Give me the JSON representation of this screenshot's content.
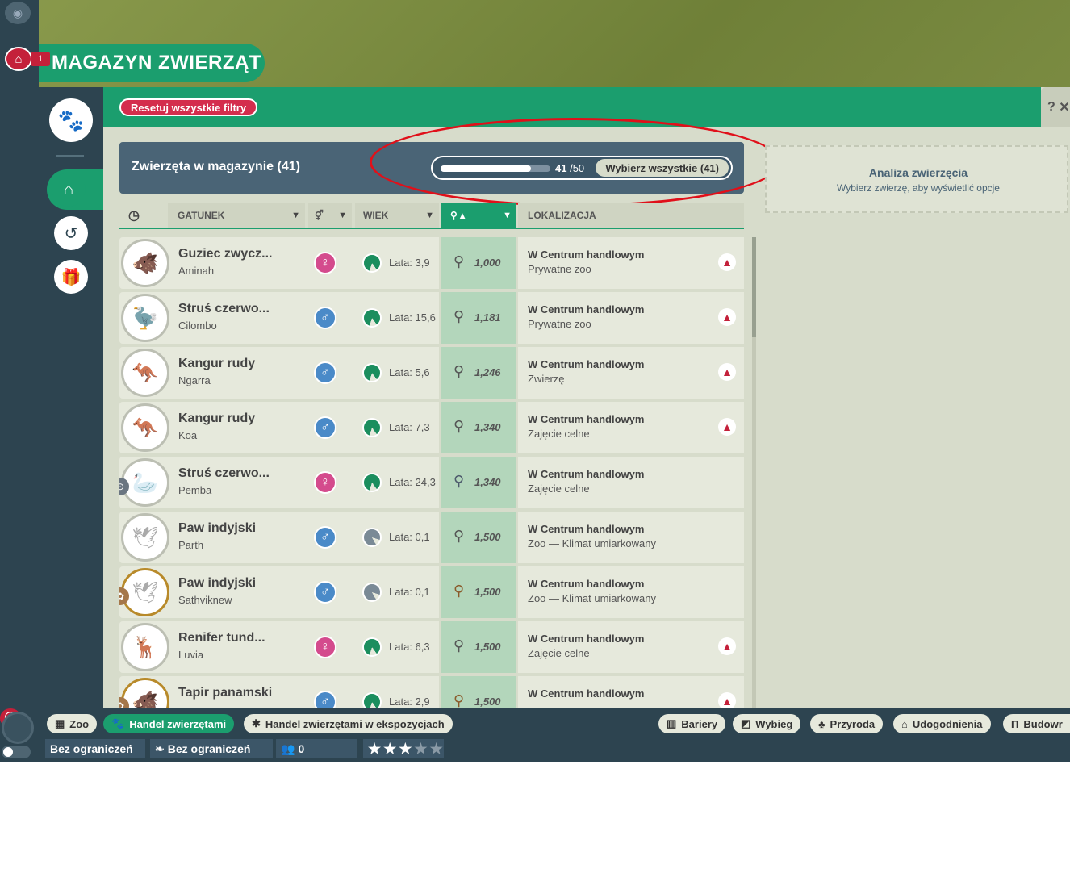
{
  "header": {
    "title": "MAGAZYN ZWIERZĄT",
    "notif_count": "1"
  },
  "toolbar": {
    "reset_label": "Resetuj wszystkie filtry",
    "help_label": "?"
  },
  "storage": {
    "title": "Zwierzęta w magazynie (41)",
    "current": "41",
    "capacity": "/50",
    "fill_fraction": 0.82,
    "select_all_label": "Wybierz wszystkie (41)"
  },
  "columns": {
    "species": "GATUNEK",
    "age": "WIEK",
    "location": "LOKALIZACJA"
  },
  "animals": [
    {
      "species": "Guziec zwycz...",
      "name": "Aminah",
      "sex": "f",
      "age": "Lata: 3,9",
      "rating": "1,000",
      "loc1": "W Centrum handlowym",
      "loc2": "Prywatne zoo",
      "warning": true,
      "avatar": "🐗"
    },
    {
      "species": "Struś czerwo...",
      "name": "Cilombo",
      "sex": "m",
      "age": "Lata: 15,6",
      "rating": "1,181",
      "loc1": "W Centrum handlowym",
      "loc2": "Prywatne zoo",
      "warning": true,
      "avatar": "🦤"
    },
    {
      "species": "Kangur rudy",
      "name": "Ngarra",
      "sex": "m",
      "age": "Lata: 5,6",
      "rating": "1,246",
      "loc1": "W Centrum handlowym",
      "loc2": "Zwierzę",
      "warning": true,
      "avatar": "🦘"
    },
    {
      "species": "Kangur rudy",
      "name": "Koa",
      "sex": "m",
      "age": "Lata: 7,3",
      "rating": "1,340",
      "loc1": "W Centrum handlowym",
      "loc2": "Zajęcie celne",
      "warning": true,
      "avatar": "🦘"
    },
    {
      "species": "Struś czerwo...",
      "name": "Pemba",
      "sex": "f",
      "age": "Lata: 24,3",
      "rating": "1,340",
      "loc1": "W Centrum handlowym",
      "loc2": "Zajęcie celne",
      "warning": false,
      "avatar": "🦢",
      "medal": "silver"
    },
    {
      "species": "Paw indyjski",
      "name": "Parth",
      "sex": "m",
      "age": "Lata: 0,1",
      "rating": "1,500",
      "loc1": "W Centrum handlowym",
      "loc2": "Zoo — Klimat umiarkowany",
      "warning": false,
      "avatar": "🕊",
      "young": true
    },
    {
      "species": "Paw indyjski",
      "name": "Sathviknew",
      "sex": "m",
      "age": "Lata: 0,1",
      "rating": "1,500",
      "loc1": "W Centrum handlowym",
      "loc2": "Zoo — Klimat umiarkowany",
      "warning": false,
      "avatar": "🕊",
      "young": true,
      "medal": "bronze"
    },
    {
      "species": "Renifer tund...",
      "name": "Luvia",
      "sex": "f",
      "age": "Lata: 6,3",
      "rating": "1,500",
      "loc1": "W Centrum handlowym",
      "loc2": "Zajęcie celne",
      "warning": true,
      "avatar": "🦌"
    },
    {
      "species": "Tapir panamski",
      "name": "",
      "sex": "m",
      "age": "Lata: 2,9",
      "rating": "1,500",
      "loc1": "W Centrum handlowym",
      "loc2": "",
      "warning": true,
      "avatar": "🐗",
      "medal": "bronze"
    }
  ],
  "analysis": {
    "title": "Analiza zwierzęcia",
    "subtitle": "Wybierz zwierzę, aby wyświetlić opcje"
  },
  "bottom_tabs": {
    "zoo": "Zoo",
    "trade": "Handel zwierzętami",
    "exhibit": "Handel zwierzętami w ekspozycjach",
    "barriers": "Bariery",
    "habitat": "Wybieg",
    "nature": "Przyroda",
    "facilities": "Udogodnienia",
    "build": "Budowr"
  },
  "stats": {
    "money": "Bez ograniczeń",
    "research": "Bez ograniczeń",
    "guests": "0",
    "stars": 3,
    "stars_max": 5
  },
  "colors": {
    "accent": "#1b9e6e",
    "danger": "#c4203a",
    "dark": "#2d4450"
  }
}
